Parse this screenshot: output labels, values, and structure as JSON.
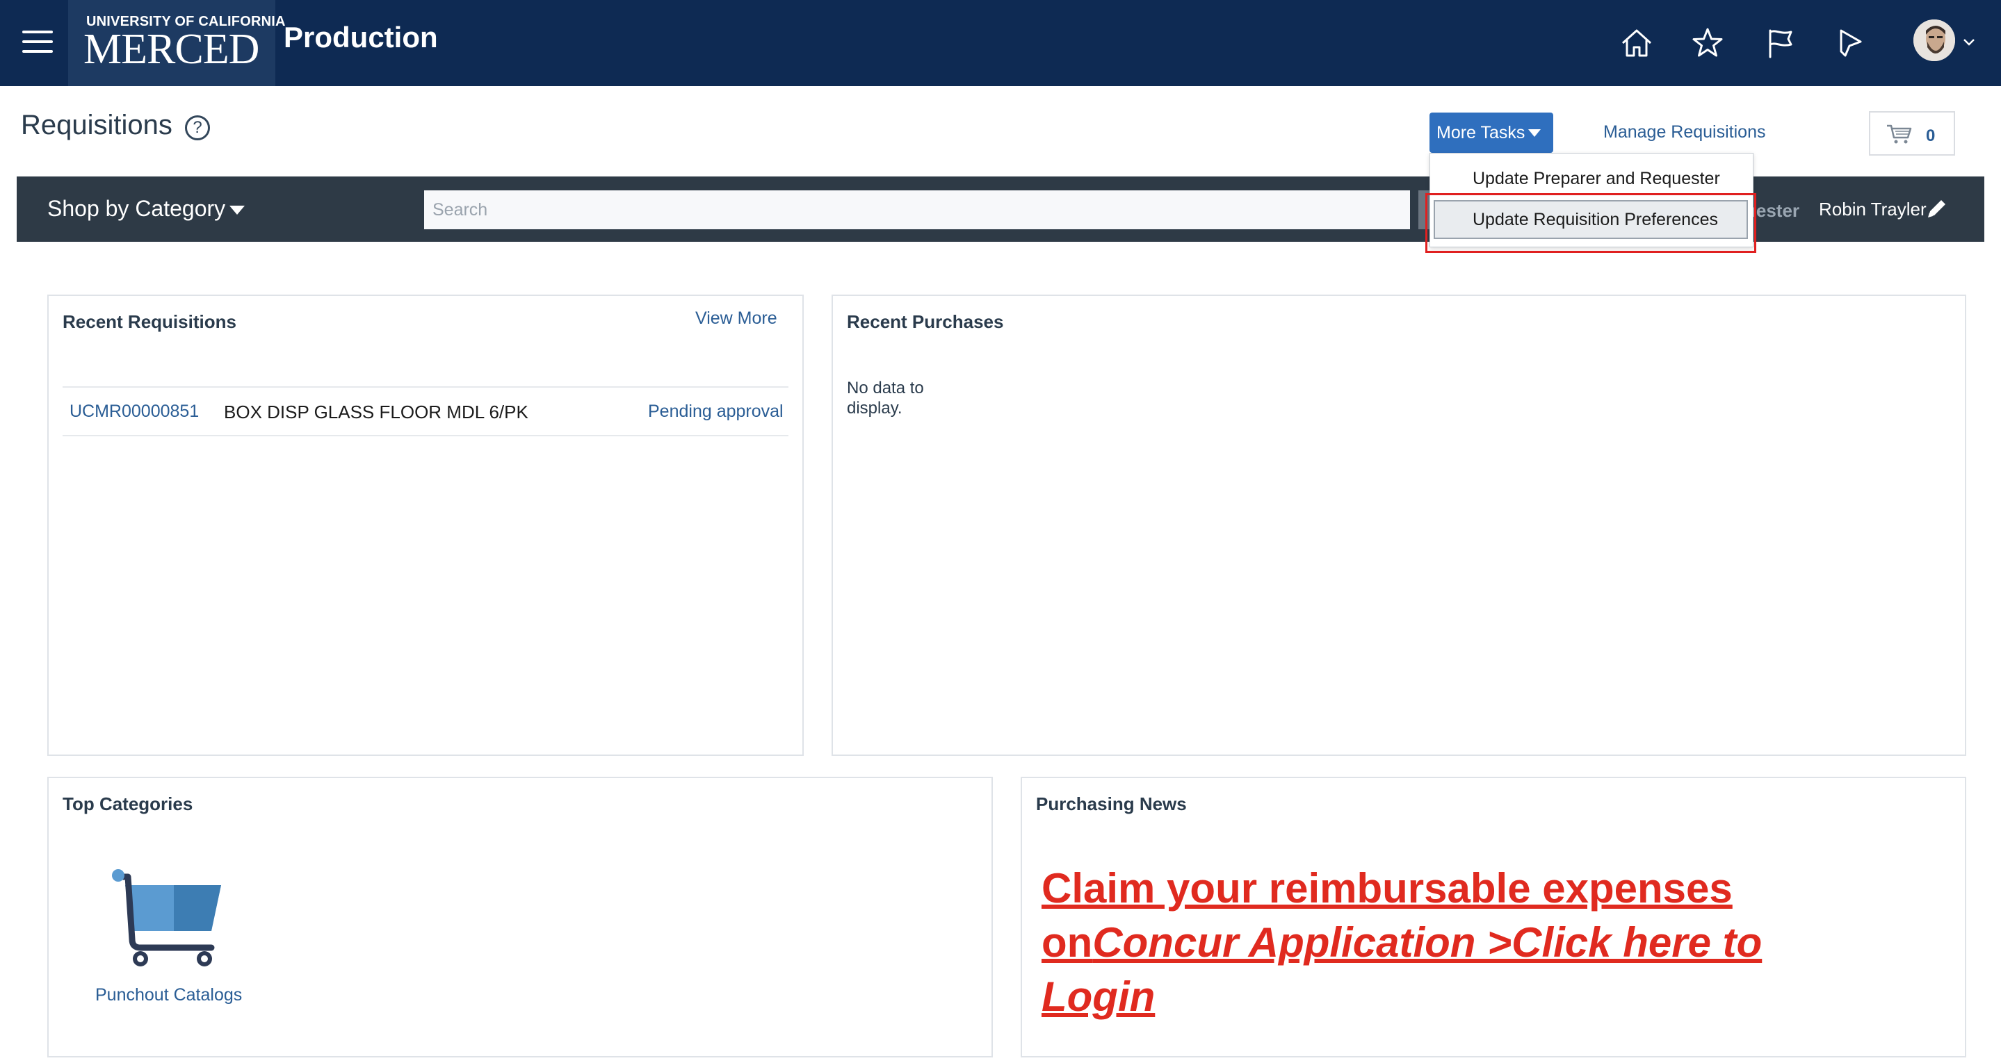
{
  "header": {
    "logo_top": "UNIVERSITY OF CALIFORNIA",
    "logo_bottom": "MERCED",
    "environment": "Production",
    "icons": [
      "home-icon",
      "favorites-star-icon",
      "notifications-flag-icon",
      "watchlist-icon",
      "user-avatar",
      "chevron-down-icon"
    ]
  },
  "page": {
    "title": "Requisitions",
    "help_glyph": "?",
    "more_tasks_label": "More Tasks",
    "manage_requisitions_label": "Manage Requisitions",
    "cart_count": "0"
  },
  "shop_bar": {
    "shop_by_category_label": "Shop by Category",
    "search_placeholder": "Search",
    "requester_label": "uester",
    "requester_name": "Robin Trayler"
  },
  "more_tasks_menu": {
    "items": [
      "Update Preparer and Requester",
      "Update Requisition Preferences"
    ],
    "highlighted_item": "Update Requisition Preferences"
  },
  "recent_requisitions": {
    "title": "Recent Requisitions",
    "view_more_label": "View More",
    "rows": [
      {
        "id": "UCMR00000851",
        "description": "BOX DISP GLASS FLOOR MDL 6/PK",
        "status": "Pending approval"
      }
    ]
  },
  "recent_purchases": {
    "title": "Recent Purchases",
    "empty_message": "No data to display."
  },
  "top_categories": {
    "title": "Top Categories",
    "items": [
      {
        "label": "Punchout Catalogs",
        "icon": "shopping-cart-icon"
      }
    ]
  },
  "purchasing_news": {
    "title": "Purchasing News",
    "line1": "Claim your reimbursable expenses",
    "line2_prefix": "on",
    "line2_link": "Concur Application >Click here to",
    "line3_link": "Login"
  },
  "colors": {
    "header_bg": "#0e2a53",
    "shop_bar_bg": "#2e3a46",
    "primary_button": "#2f6fbe",
    "link": "#2a5d95",
    "highlight_red": "#e02020",
    "news_red": "#e02a1f"
  }
}
